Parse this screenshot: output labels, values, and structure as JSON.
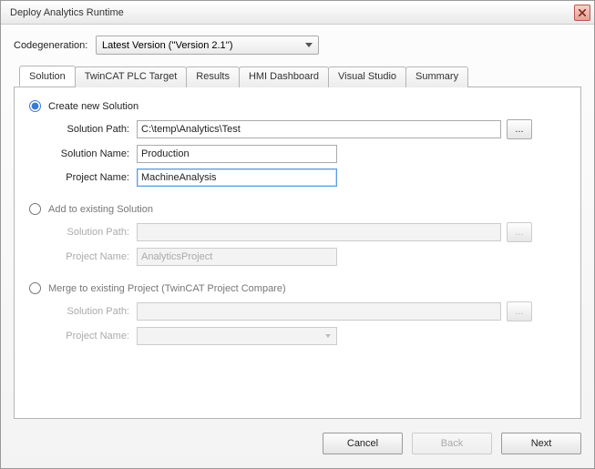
{
  "window": {
    "title": "Deploy Analytics Runtime"
  },
  "codegen": {
    "label": "Codegeneration:",
    "selected": "Latest Version (''Version 2.1'')"
  },
  "tabs": {
    "solution": "Solution",
    "plc_target": "TwinCAT PLC Target",
    "results": "Results",
    "hmi": "HMI Dashboard",
    "vs": "Visual Studio",
    "summary": "Summary"
  },
  "options": {
    "create": {
      "title": "Create new Solution",
      "solution_path_label": "Solution Path:",
      "solution_path": "C:\\temp\\Analytics\\Test",
      "solution_name_label": "Solution Name:",
      "solution_name": "Production",
      "project_name_label": "Project Name:",
      "project_name": "MachineAnalysis"
    },
    "add": {
      "title": "Add to existing Solution",
      "solution_path_label": "Solution Path:",
      "solution_path": "",
      "project_name_label": "Project Name:",
      "project_name": "AnalyticsProject"
    },
    "merge": {
      "title": "Merge to existing Project (TwinCAT Project Compare)",
      "solution_path_label": "Solution Path:",
      "solution_path": "",
      "project_name_label": "Project Name:",
      "project_name": ""
    }
  },
  "buttons": {
    "browse": "...",
    "cancel": "Cancel",
    "back": "Back",
    "next": "Next"
  }
}
